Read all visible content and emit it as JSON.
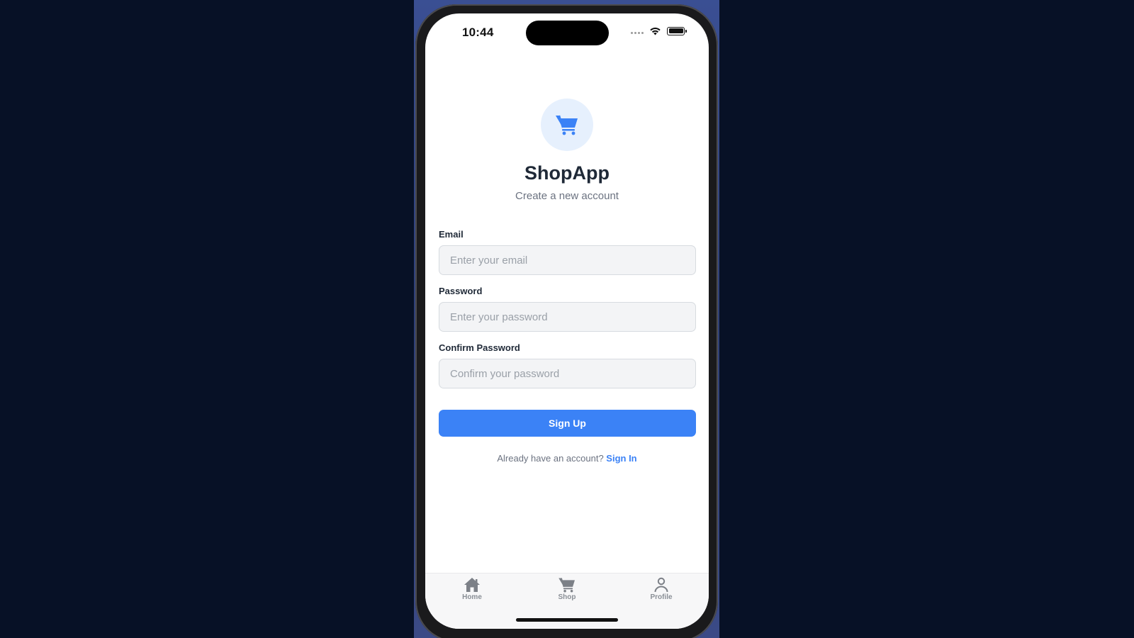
{
  "status_bar": {
    "time": "10:44"
  },
  "app": {
    "title": "ShopApp",
    "subtitle": "Create a new account",
    "logo_icon": "cart-icon",
    "accent_color": "#3b82f6"
  },
  "form": {
    "email": {
      "label": "Email",
      "placeholder": "Enter your email",
      "value": ""
    },
    "password": {
      "label": "Password",
      "placeholder": "Enter your password",
      "value": ""
    },
    "confirm_password": {
      "label": "Confirm Password",
      "placeholder": "Confirm your password",
      "value": ""
    },
    "submit_label": "Sign Up"
  },
  "signin": {
    "prompt": "Already have an account?",
    "link_label": "Sign In"
  },
  "tab_bar": {
    "items": [
      {
        "label": "Home",
        "icon": "home-icon"
      },
      {
        "label": "Shop",
        "icon": "cart-icon"
      },
      {
        "label": "Profile",
        "icon": "person-icon"
      }
    ]
  }
}
